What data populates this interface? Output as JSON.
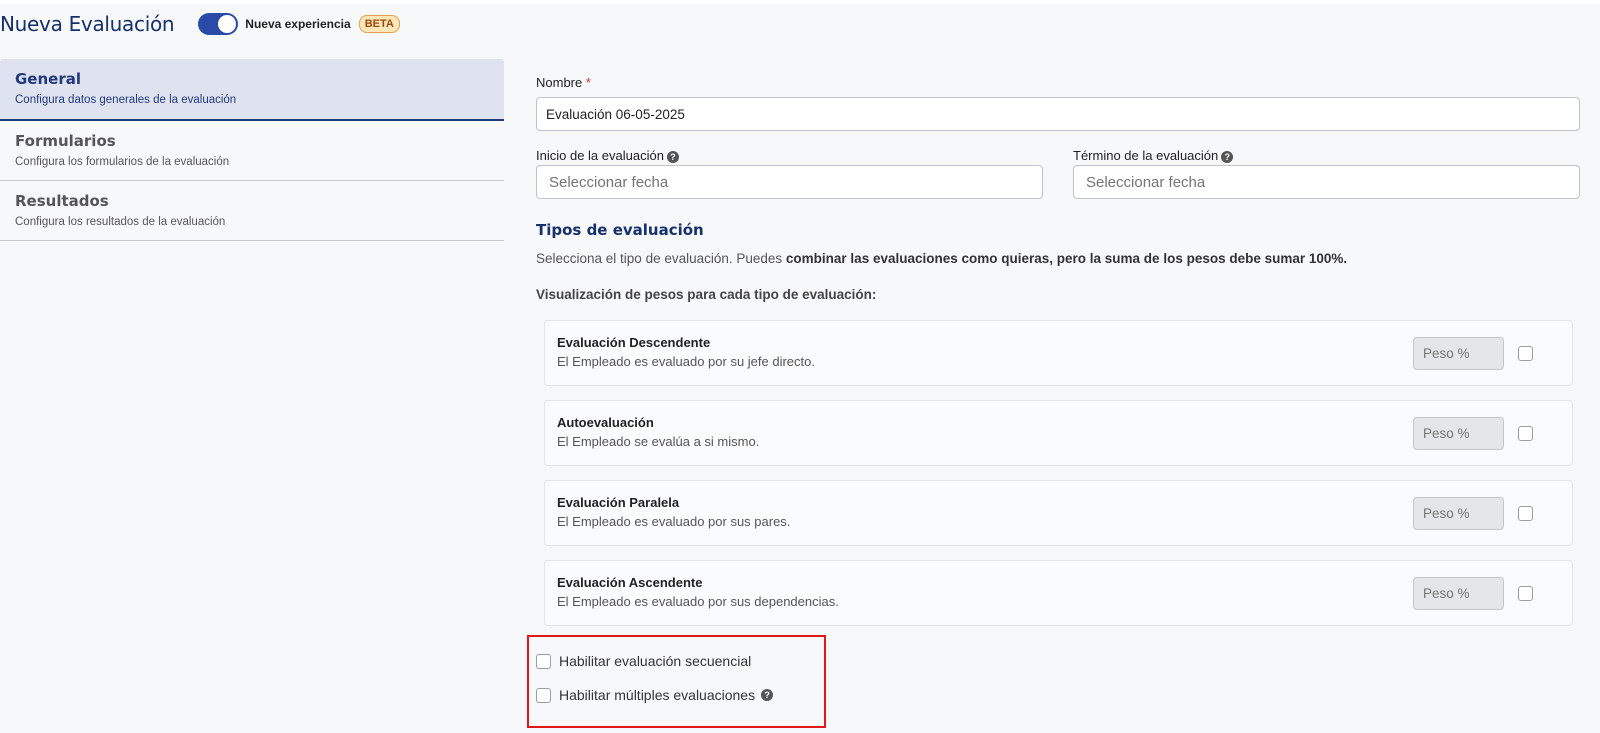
{
  "header": {
    "title": "Nueva Evaluación",
    "toggle_label": "Nueva experiencia",
    "badge": "BETA",
    "toggle_on": true
  },
  "sidebar": {
    "items": [
      {
        "title": "General",
        "desc": "Configura datos generales de la evaluación",
        "active": true
      },
      {
        "title": "Formularios",
        "desc": "Configura los formularios de la evaluación",
        "active": false
      },
      {
        "title": "Resultados",
        "desc": "Configura los resultados de la evaluación",
        "active": false
      }
    ]
  },
  "form": {
    "name_label": "Nombre",
    "required_mark": "*",
    "name_value": "Evaluación 06-05-2025",
    "start_label": "Inicio de la evaluación",
    "end_label": "Término de la evaluación",
    "date_placeholder": "Seleccionar fecha",
    "help_glyph": "?"
  },
  "types": {
    "title": "Tipos de evaluación",
    "intro_prefix": "Selecciona el tipo de evaluación. Puedes ",
    "intro_bold": "combinar las evaluaciones como quieras, pero la suma de los pesos debe sumar 100%.",
    "weights_title": "Visualización de pesos para cada tipo de evaluación:",
    "weight_placeholder": "Peso %",
    "cards": [
      {
        "title": "Evaluación Descendente",
        "desc": "El Empleado es evaluado por su jefe directo."
      },
      {
        "title": "Autoevaluación",
        "desc": "El Empleado se evalúa a si mismo."
      },
      {
        "title": "Evaluación Paralela",
        "desc": "El Empleado es evaluado por sus pares."
      },
      {
        "title": "Evaluación Ascendente",
        "desc": "El Empleado es evaluado por sus dependencias."
      }
    ]
  },
  "options": {
    "sequential": "Habilitar evaluación secuencial",
    "multiple": "Habilitar múltiples evaluaciones"
  },
  "colors": {
    "accent": "#23397d",
    "title": "#16306b",
    "toggle": "#2a4aa8",
    "highlight_box": "#e01818"
  }
}
